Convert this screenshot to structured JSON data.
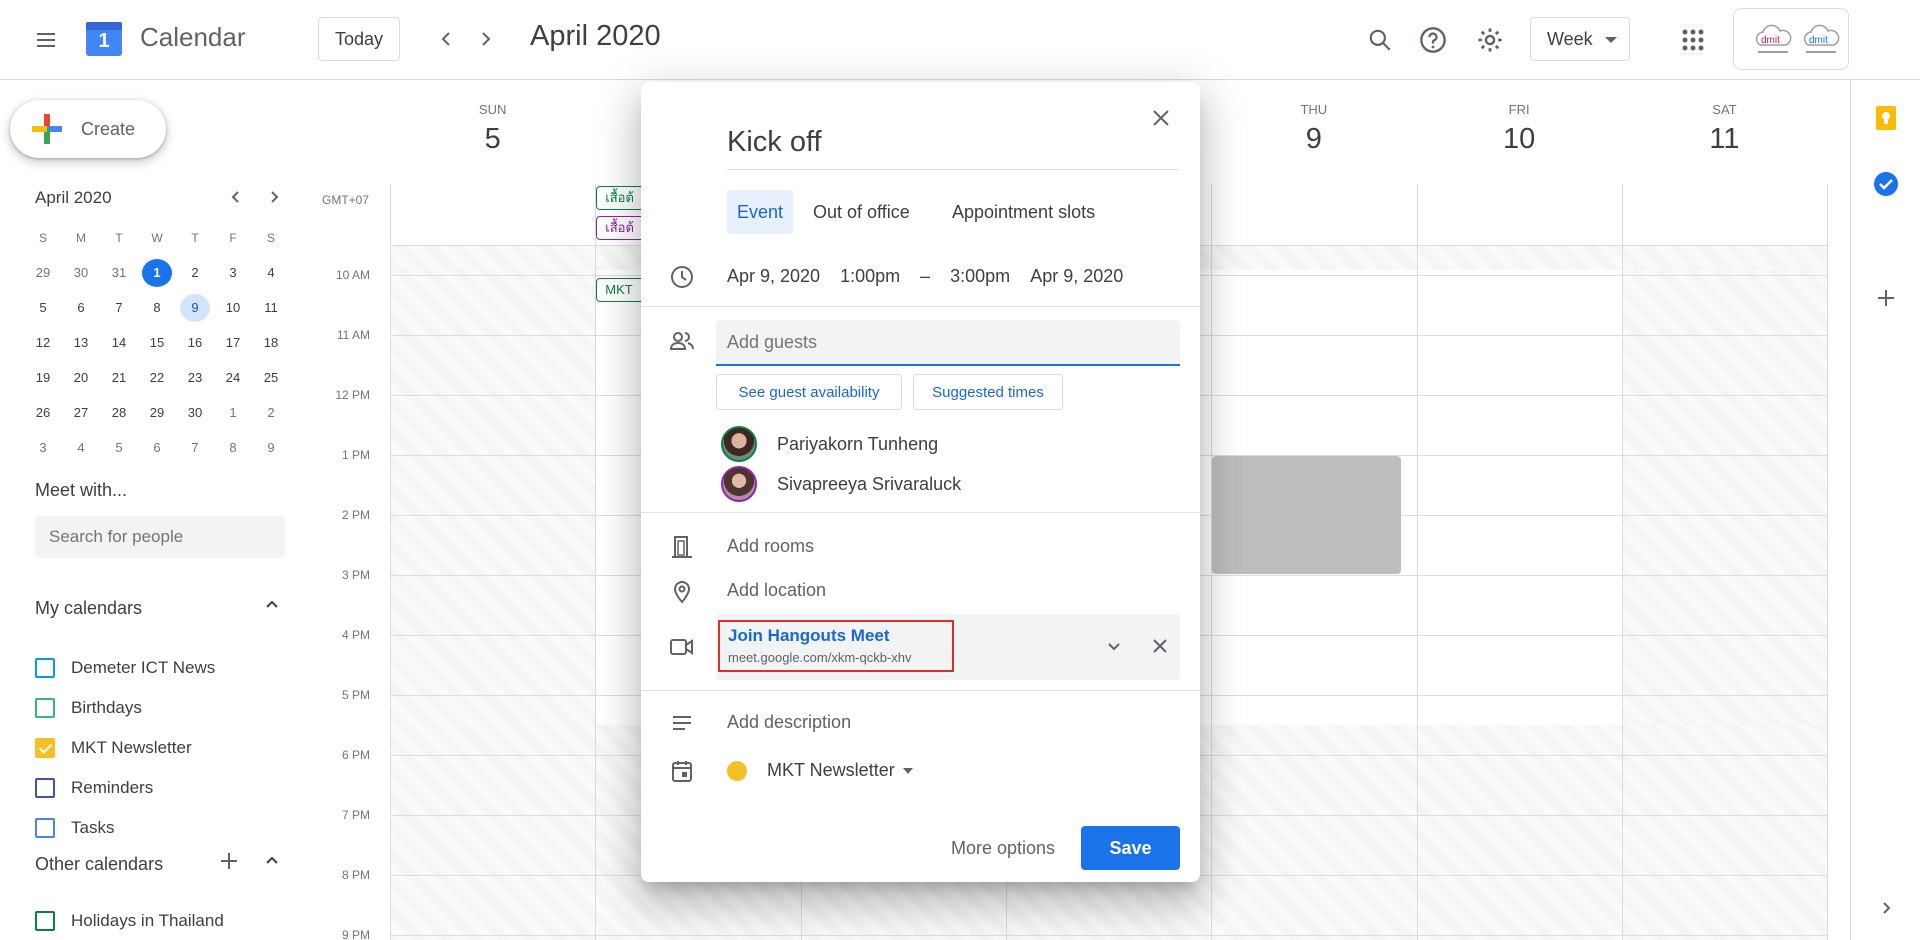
{
  "header": {
    "app_title": "Calendar",
    "logo_day": "1",
    "today_label": "Today",
    "date_title": "April 2020",
    "view_label": "Week",
    "account_logo_text": "dmit"
  },
  "sidebar": {
    "create_label": "Create",
    "mini_calendar": {
      "title": "April 2020",
      "weekdays": [
        "S",
        "M",
        "T",
        "W",
        "T",
        "F",
        "S"
      ],
      "weeks": [
        [
          "29",
          "30",
          "31",
          "1",
          "2",
          "3",
          "4"
        ],
        [
          "5",
          "6",
          "7",
          "8",
          "9",
          "10",
          "11"
        ],
        [
          "12",
          "13",
          "14",
          "15",
          "16",
          "17",
          "18"
        ],
        [
          "19",
          "20",
          "21",
          "22",
          "23",
          "24",
          "25"
        ],
        [
          "26",
          "27",
          "28",
          "29",
          "30",
          "1",
          "2"
        ],
        [
          "3",
          "4",
          "5",
          "6",
          "7",
          "8",
          "9"
        ]
      ],
      "today": "1",
      "selected": "9"
    },
    "meet_with": "Meet with...",
    "people_search_placeholder": "Search for people",
    "my_calendars_title": "My calendars",
    "my_calendars": [
      {
        "label": "Demeter ICT News",
        "color": "#039be5",
        "checked": false
      },
      {
        "label": "Birthdays",
        "color": "#33b679",
        "checked": false
      },
      {
        "label": "MKT Newsletter",
        "color": "#f6bf26",
        "checked": true
      },
      {
        "label": "Reminders",
        "color": "#3f51b5",
        "checked": false
      },
      {
        "label": "Tasks",
        "color": "#4285f4",
        "checked": false
      }
    ],
    "other_calendars_title": "Other calendars",
    "other_calendars": [
      {
        "label": "Holidays in Thailand",
        "color": "#0b8043",
        "checked": false
      }
    ]
  },
  "grid": {
    "timezone": "GMT+07",
    "days": [
      {
        "name": "SUN",
        "date": "5"
      },
      {
        "name": "",
        "date": ""
      },
      {
        "name": "",
        "date": ""
      },
      {
        "name": "",
        "date": ""
      },
      {
        "name": "THU",
        "date": "9"
      },
      {
        "name": "FRI",
        "date": "10"
      },
      {
        "name": "SAT",
        "date": "11"
      }
    ],
    "hours": [
      "10 AM",
      "11 AM",
      "12 PM",
      "1 PM",
      "2 PM",
      "3 PM",
      "4 PM",
      "5 PM",
      "6 PM",
      "7 PM",
      "8 PM",
      "9 PM"
    ],
    "event_chips": [
      {
        "label": "เสื้อต้",
        "color": "#0b8043"
      },
      {
        "label": "เสื้อต้",
        "color": "#8e24aa"
      },
      {
        "label": "MKT",
        "color": "#0b8043"
      }
    ]
  },
  "dialog": {
    "title": "Kick off",
    "tabs": [
      "Event",
      "Out of office",
      "Appointment slots"
    ],
    "start_date": "Apr 9, 2020",
    "start_time": "1:00pm",
    "dash": "–",
    "end_time": "3:00pm",
    "end_date": "Apr 9, 2020",
    "guests_placeholder": "Add guests",
    "availability_button": "See guest availability",
    "suggested_button": "Suggested times",
    "guests": [
      {
        "name": "Pariyakorn Tunheng",
        "ring": "#0b8043"
      },
      {
        "name": "Sivapreeya Srivaraluck",
        "ring": "#8e24aa"
      }
    ],
    "rooms_label": "Add rooms",
    "location_label": "Add location",
    "conference_title": "Join Hangouts Meet",
    "conference_url": "meet.google.com/xkm-qckb-xhv",
    "description_label": "Add description",
    "calendar_name": "MKT Newsletter",
    "calendar_color": "#f6bf26",
    "more_options": "More options",
    "save": "Save"
  }
}
